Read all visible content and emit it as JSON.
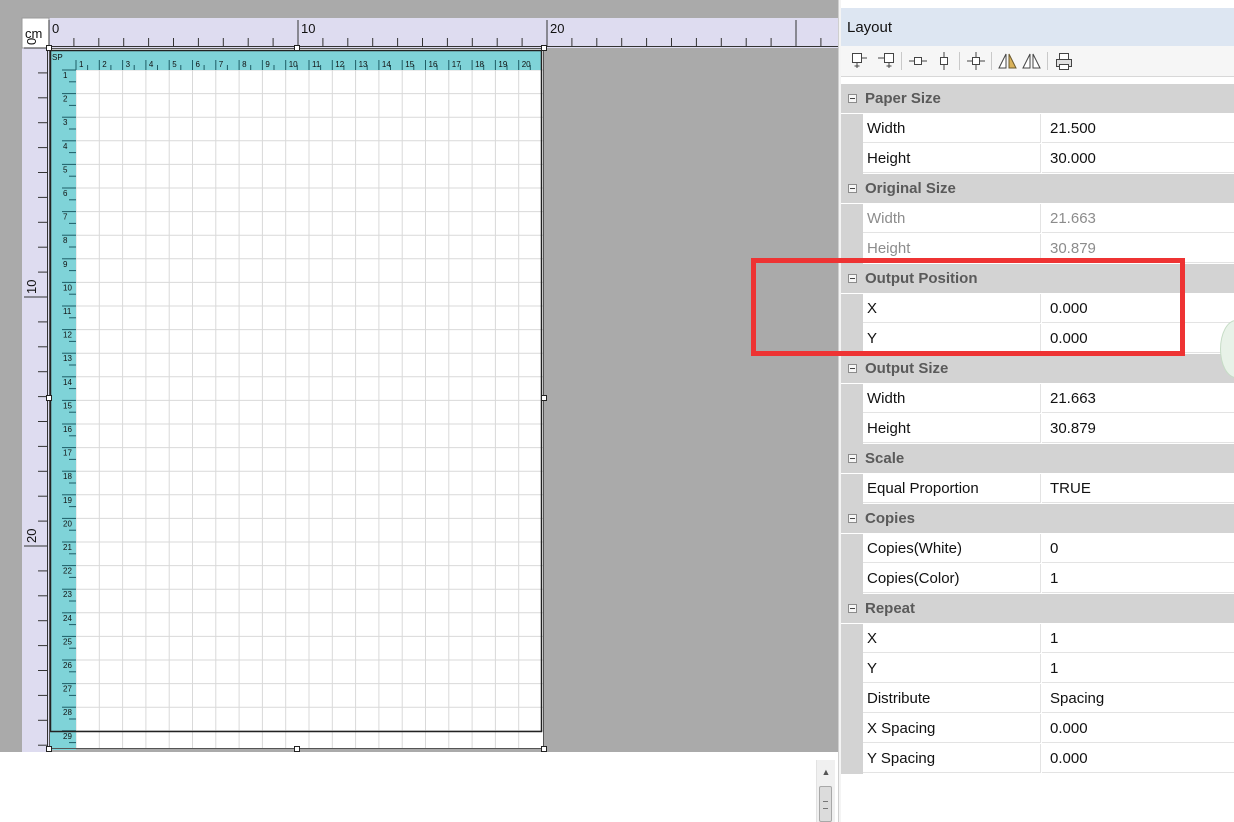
{
  "canvas": {
    "ruler_unit": "cm",
    "horizontal_ruler_labels": [
      "0",
      "10",
      "20"
    ],
    "vertical_ruler_labels": [
      "0",
      "10",
      "20"
    ],
    "sheet_column_numbers": [
      "1",
      "2",
      "3",
      "4",
      "5",
      "6",
      "7",
      "8",
      "9",
      "10",
      "11",
      "12",
      "13",
      "14",
      "15",
      "16",
      "17",
      "18",
      "19",
      "20"
    ],
    "sheet_row_numbers": [
      "1",
      "2",
      "3",
      "4",
      "5",
      "6",
      "7",
      "8",
      "9",
      "10",
      "11",
      "12",
      "13",
      "14",
      "15",
      "16",
      "17",
      "18",
      "19",
      "20",
      "21",
      "22",
      "23",
      "24",
      "25",
      "26",
      "27",
      "28",
      "29"
    ],
    "sheet_corner_label": "SP",
    "colors": {
      "background": "#aaaaaa",
      "sheet_ruler": "#7fd3d8",
      "grid_line": "#d9d9d9"
    }
  },
  "panel": {
    "title": "Layout",
    "toolbar_icons": [
      "align-top-left-icon",
      "align-top-right-icon",
      "align-horizontal-center-icon",
      "align-vertical-center-icon",
      "align-center-icon",
      "flip-horizontal-icon",
      "mirror-icon",
      "print-icon"
    ],
    "groups": [
      {
        "name": "Paper Size",
        "props": [
          {
            "name": "Width",
            "value": "21.500"
          },
          {
            "name": "Height",
            "value": "30.000"
          }
        ]
      },
      {
        "name": "Original Size",
        "disabled": true,
        "props": [
          {
            "name": "Width",
            "value": "21.663"
          },
          {
            "name": "Height",
            "value": "30.879"
          }
        ]
      },
      {
        "name": "Output Position",
        "props": [
          {
            "name": "X",
            "value": "0.000"
          },
          {
            "name": "Y",
            "value": "0.000"
          }
        ]
      },
      {
        "name": "Output Size",
        "props": [
          {
            "name": "Width",
            "value": "21.663"
          },
          {
            "name": "Height",
            "value": "30.879"
          }
        ]
      },
      {
        "name": "Scale",
        "props": [
          {
            "name": "Equal Proportion",
            "value": "TRUE"
          }
        ]
      },
      {
        "name": "Copies",
        "props": [
          {
            "name": "Copies(White)",
            "value": "0"
          },
          {
            "name": "Copies(Color)",
            "value": "1"
          }
        ]
      },
      {
        "name": "Repeat",
        "props": [
          {
            "name": "X",
            "value": "1"
          },
          {
            "name": "Y",
            "value": "1"
          },
          {
            "name": "Distribute",
            "value": "Spacing"
          },
          {
            "name": "X Spacing",
            "value": "0.000"
          },
          {
            "name": "Y Spacing",
            "value": "0.000"
          }
        ]
      }
    ],
    "highlight_color": "#ee3333"
  }
}
